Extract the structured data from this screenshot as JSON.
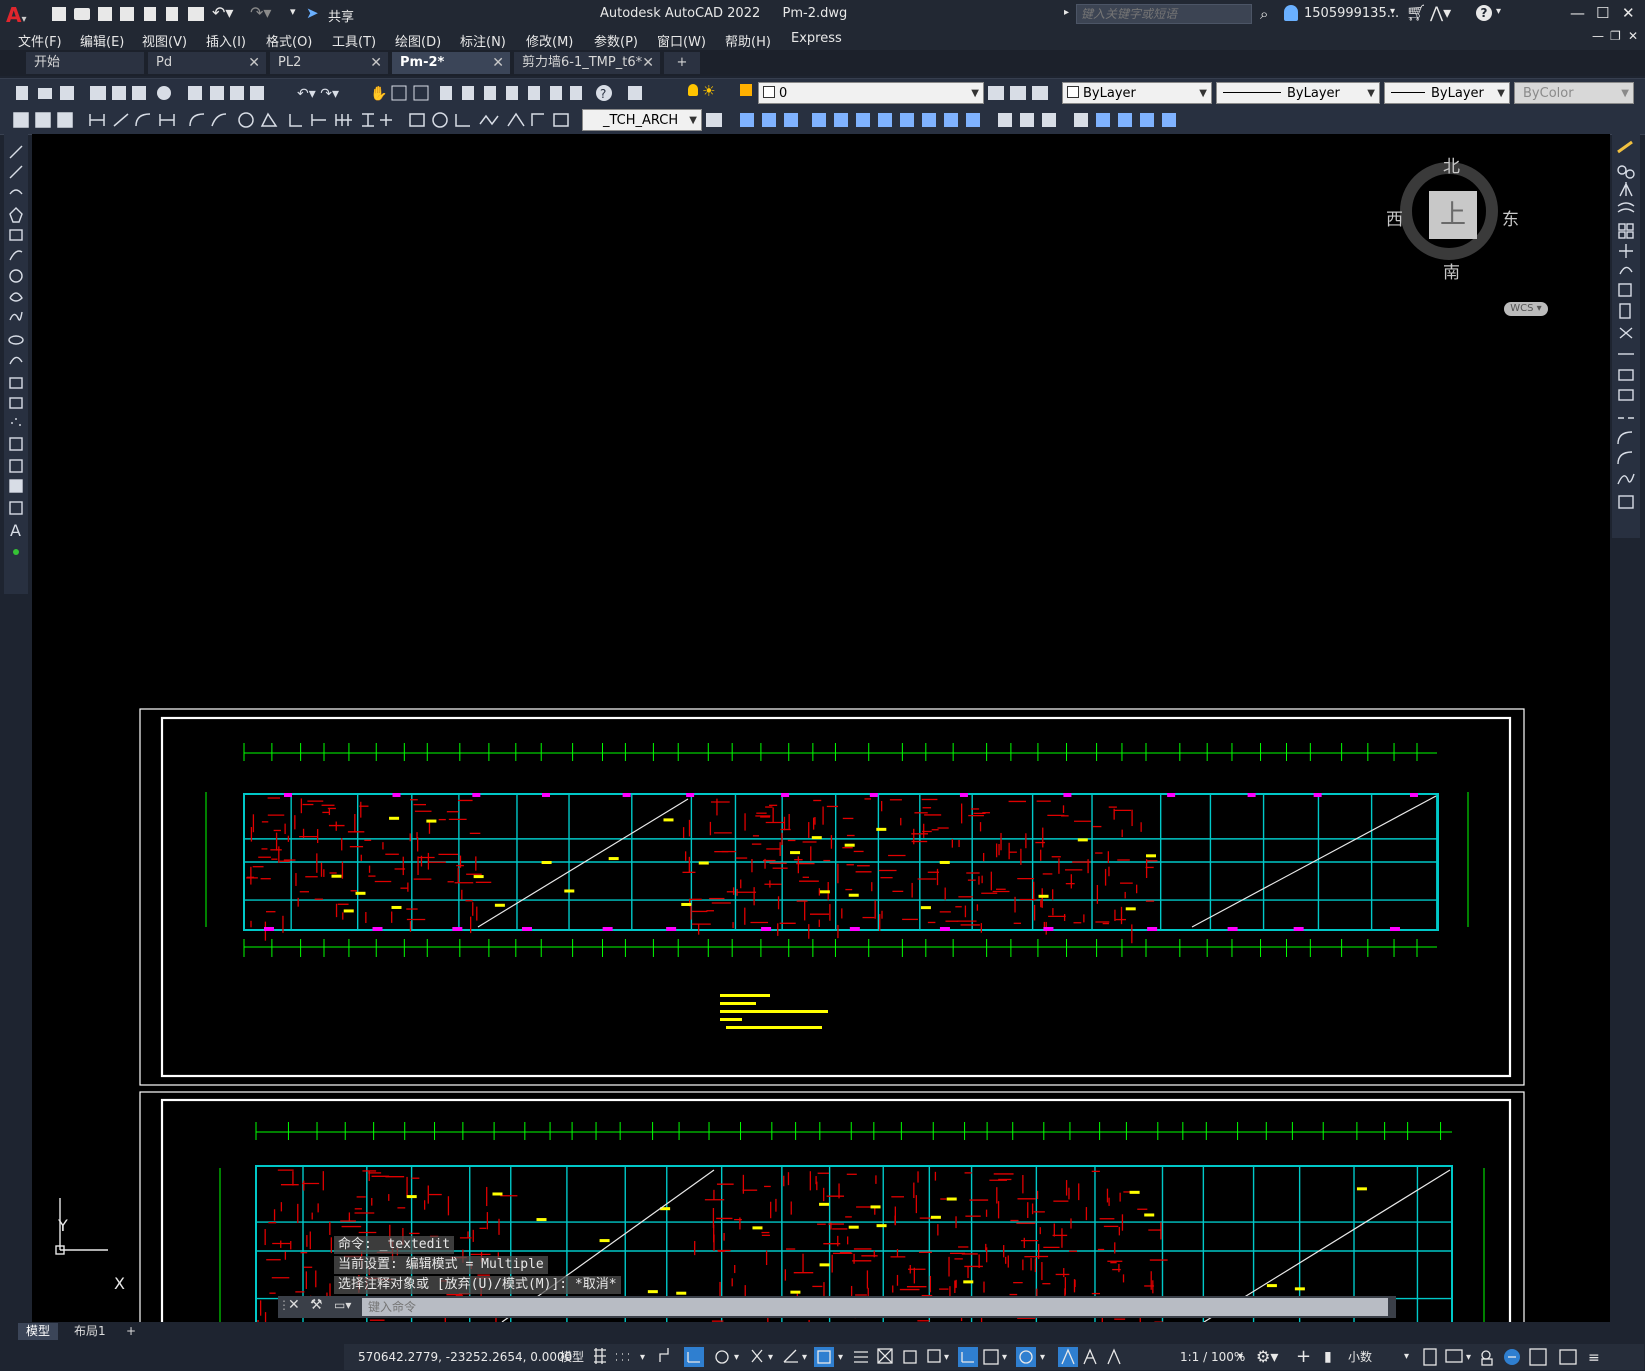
{
  "app": {
    "title": "Autodesk AutoCAD 2022",
    "file": "Pm-2.dwg",
    "search_placeholder": "键入关键字或短语",
    "user": "1505999135...",
    "share_label": "共享"
  },
  "menu": {
    "items": [
      "文件(F)",
      "编辑(E)",
      "视图(V)",
      "插入(I)",
      "格式(O)",
      "工具(T)",
      "绘图(D)",
      "标注(N)",
      "修改(M)",
      "参数(P)",
      "窗口(W)",
      "帮助(H)",
      "Express"
    ]
  },
  "tabs": [
    {
      "label": "开始",
      "active": false,
      "closable": false
    },
    {
      "label": "Pd",
      "active": false,
      "closable": true
    },
    {
      "label": "PL2",
      "active": false,
      "closable": true
    },
    {
      "label": "Pm-2*",
      "active": true,
      "closable": true
    },
    {
      "label": "剪力墙6-1_TMP_t6*",
      "active": false,
      "closable": true
    }
  ],
  "toolbar": {
    "layer_value": "0",
    "color_value": "ByLayer",
    "linetype_value": "ByLayer",
    "lineweight_value": "ByLayer",
    "plotstyle_value": "ByColor",
    "dimstyle_value": "_TCH_ARCH"
  },
  "viewcube": {
    "north": "北",
    "south": "南",
    "west": "西",
    "east": "东",
    "face": "上",
    "wcs": "WCS"
  },
  "ucs": {
    "x_label": "X",
    "y_label": "Y"
  },
  "command": {
    "history": [
      "命令: _textedit",
      "当前设置: 编辑模式 = Multiple",
      "选择注释对象或 [放弃(U)/模式(M)]: *取消*"
    ],
    "placeholder": "键入命令"
  },
  "layout_tabs": [
    "模型",
    "布局1"
  ],
  "status": {
    "coords": "570642.2779, -23252.2654, 0.0000",
    "model": "模型",
    "scale": "1:1 / 100%",
    "units": "小数"
  },
  "colors": {
    "background": "#000000",
    "cad_green": "#00ff00",
    "cad_cyan": "#00c8c8",
    "cad_red": "#e00000",
    "cad_yellow": "#ffff00",
    "cad_magenta": "#ff00ff"
  }
}
